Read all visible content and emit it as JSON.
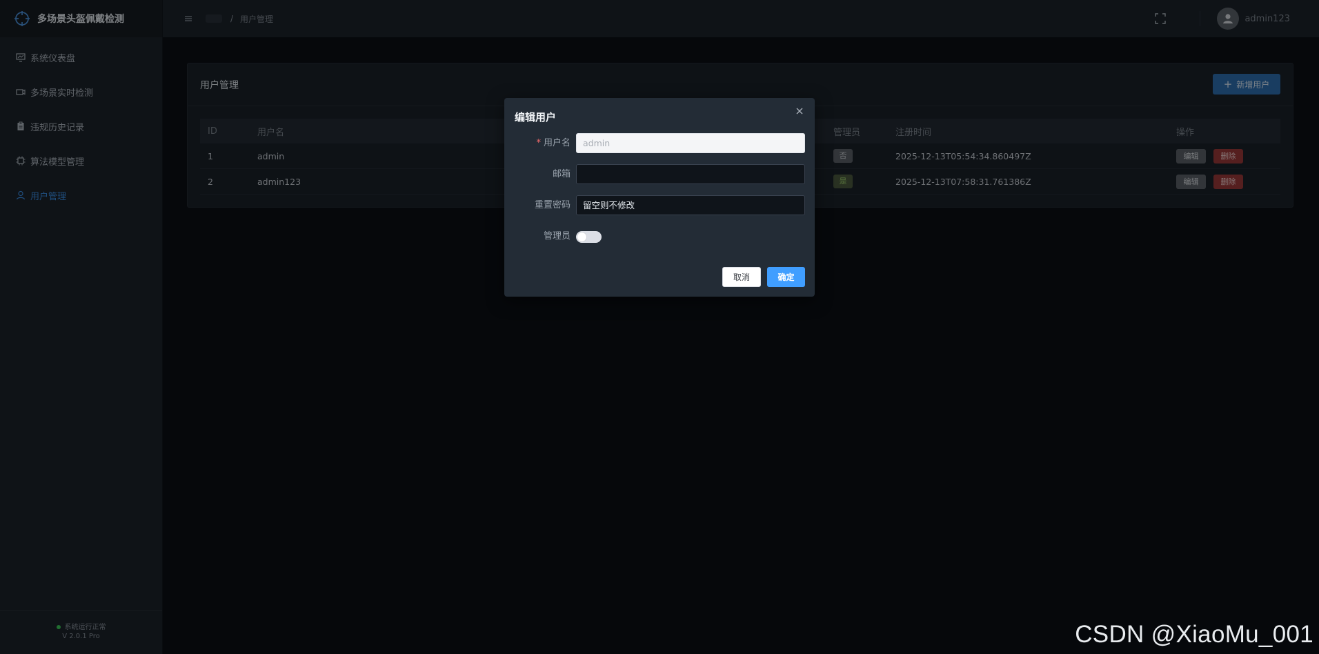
{
  "app": {
    "title": "多场景头盔佩戴检测"
  },
  "sidebar": {
    "items": [
      {
        "label": "系统仪表盘",
        "icon": "monitor-icon",
        "active": false
      },
      {
        "label": "多场景实时检测",
        "icon": "video-camera-icon",
        "active": false
      },
      {
        "label": "违规历史记录",
        "icon": "clipboard-icon",
        "active": false
      },
      {
        "label": "算法模型管理",
        "icon": "cpu-icon",
        "active": false
      },
      {
        "label": "用户管理",
        "icon": "user-icon",
        "active": true
      }
    ],
    "footer": {
      "status": "系统运行正常",
      "version": "V 2.0.1 Pro"
    }
  },
  "header": {
    "breadcrumb_sep": "/",
    "breadcrumb_current": "用户管理",
    "username": "admin123"
  },
  "card": {
    "title": "用户管理",
    "add_button": "新增用户",
    "add_icon": "+"
  },
  "table": {
    "columns": {
      "id": "ID",
      "username": "用户名",
      "admin": "管理员",
      "registered": "注册时间",
      "actions": "操作"
    },
    "rows": [
      {
        "id": "1",
        "username": "admin",
        "admin": "否",
        "registered": "2025-12-13T05:54:34.860497Z"
      },
      {
        "id": "2",
        "username": "admin123",
        "admin": "是",
        "registered": "2025-12-13T07:58:31.761386Z"
      }
    ],
    "edit_label": "编辑",
    "delete_label": "删除"
  },
  "modal": {
    "title": "编辑用户",
    "required_mark": "*",
    "username_label": "用户名",
    "username_placeholder": "admin",
    "email_label": "邮箱",
    "email_value": "",
    "password_label": "重置密码",
    "password_placeholder": "留空则不修改",
    "admin_label": "管理员",
    "admin_on": false,
    "cancel_label": "取消",
    "ok_label": "确定"
  },
  "watermark": "CSDN @XiaoMu_001",
  "colors": {
    "accent": "#409eff",
    "active_menu": "#3a8ee6",
    "danger": "#9b3a3a",
    "status_ok": "#3cc85a"
  }
}
